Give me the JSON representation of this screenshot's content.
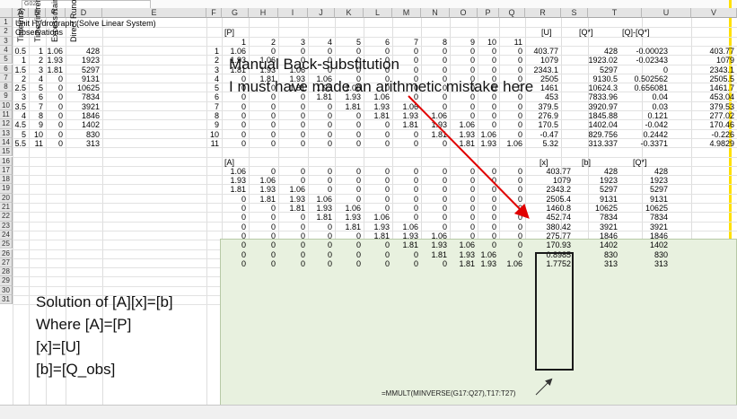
{
  "app": {
    "name_box": "G02"
  },
  "columns": [
    "A",
    "B",
    "C",
    "D",
    "E",
    "F",
    "G",
    "H",
    "I",
    "J",
    "K",
    "L",
    "M",
    "N",
    "O",
    "P",
    "Q",
    "R",
    "S",
    "T",
    "U",
    "V"
  ],
  "rows": [
    "1",
    "2",
    "3",
    "4",
    "5",
    "6",
    "7",
    "8",
    "9",
    "10",
    "11",
    "12",
    "13",
    "14",
    "15",
    "16",
    "17",
    "18",
    "19",
    "20",
    "21",
    "22",
    "23",
    "24",
    "25",
    "26",
    "27",
    "28",
    "29",
    "30",
    "31"
  ],
  "sheet": {
    "title": "Unit Hydrograph (Solve Linear System)",
    "observations": "Observations",
    "p_label": "[P]",
    "u_label": "[U]",
    "q_star_label": "[Q*]",
    "diff_label": "[Q]-[Q*]",
    "col_time": "Time(hrs)",
    "col_increment": "Time (increment)",
    "col_excess": "Excess Rain (in)",
    "col_runoff": "Direct Runoff (cfs",
    "obs": [
      [
        "0.5",
        "1",
        "1.06",
        "428"
      ],
      [
        "1",
        "2",
        "1.93",
        "1923"
      ],
      [
        "1.5",
        "3",
        "1.81",
        "5297"
      ],
      [
        "2",
        "4",
        "0",
        "9131"
      ],
      [
        "2.5",
        "5",
        "0",
        "10625"
      ],
      [
        "3",
        "6",
        "0",
        "7834"
      ],
      [
        "3.5",
        "7",
        "0",
        "3921"
      ],
      [
        "4",
        "8",
        "0",
        "1846"
      ],
      [
        "4.5",
        "9",
        "0",
        "1402"
      ],
      [
        "5",
        "10",
        "0",
        "830"
      ],
      [
        "5.5",
        "11",
        "0",
        "313"
      ]
    ],
    "p_header": [
      "1",
      "2",
      "3",
      "4",
      "5",
      "6",
      "7",
      "8",
      "9",
      "10",
      "11"
    ],
    "p_index": [
      "1",
      "2",
      "3",
      "4",
      "5",
      "6",
      "7",
      "8",
      "9",
      "10",
      "11"
    ],
    "p_matrix": [
      [
        "1.06",
        "0",
        "0",
        "0",
        "0",
        "0",
        "0",
        "0",
        "0",
        "0",
        "0"
      ],
      [
        "1.93",
        "1.06",
        "0",
        "0",
        "0",
        "0",
        "0",
        "0",
        "0",
        "0",
        "0"
      ],
      [
        "1.81",
        "1.93",
        "1.06",
        "0",
        "0",
        "0",
        "0",
        "0",
        "0",
        "0",
        "0"
      ],
      [
        "0",
        "1.81",
        "1.93",
        "1.06",
        "0",
        "0",
        "0",
        "0",
        "0",
        "0",
        "0"
      ],
      [
        "0",
        "0",
        "1.81",
        "1.93",
        "1.06",
        "0",
        "0",
        "0",
        "0",
        "0",
        "0"
      ],
      [
        "0",
        "0",
        "0",
        "1.81",
        "1.93",
        "1.06",
        "0",
        "0",
        "0",
        "0",
        "0"
      ],
      [
        "0",
        "0",
        "0",
        "0",
        "1.81",
        "1.93",
        "1.06",
        "0",
        "0",
        "0",
        "0"
      ],
      [
        "0",
        "0",
        "0",
        "0",
        "0",
        "1.81",
        "1.93",
        "1.06",
        "0",
        "0",
        "0"
      ],
      [
        "0",
        "0",
        "0",
        "0",
        "0",
        "0",
        "1.81",
        "1.93",
        "1.06",
        "0",
        "0"
      ],
      [
        "0",
        "0",
        "0",
        "0",
        "0",
        "0",
        "0",
        "1.81",
        "1.93",
        "1.06",
        "0"
      ],
      [
        "0",
        "0",
        "0",
        "0",
        "0",
        "0",
        "0",
        "0",
        "1.81",
        "1.93",
        "1.06"
      ]
    ],
    "u": [
      "403.77",
      "1079",
      "2343.1",
      "2505",
      "1461",
      "453",
      "379.5",
      "276.9",
      "170.5",
      "-0.47",
      "5.32"
    ],
    "q_star": [
      "428",
      "1923.02",
      "5297",
      "9130.5",
      "10624.3",
      "7833.96",
      "3920.97",
      "1845.88",
      "1402.04",
      "829.756",
      "313.337"
    ],
    "diff": [
      "-0.00023",
      "-0.02343",
      "0",
      "0.502562",
      "0.656081",
      "0.04",
      "0.03",
      "0.121",
      "-0.042",
      "0.2442",
      "-0.3371"
    ],
    "v_col": [
      "403.77",
      "1079",
      "2343.1",
      "2505.5",
      "1461.7",
      "453.04",
      "379.53",
      "277.02",
      "170.46",
      "-0.226",
      "4.9829"
    ]
  },
  "annotations": {
    "manual_1": "Manual Back-substitution",
    "manual_2": "I must have made an arithmetic mistake here",
    "solution_1": "Solution of [A][x]=[b]",
    "solution_2": "Where [A]=[P]",
    "solution_3": "[x]=[U]",
    "solution_4": "[b]=[Q_obs]"
  },
  "green": {
    "a_label": "[A]",
    "x_label": "[x]",
    "b_label": "[b]",
    "q_star_label": "[Q*]",
    "a_matrix": [
      [
        "1.06",
        "0",
        "0",
        "0",
        "0",
        "0",
        "0",
        "0",
        "0",
        "0",
        "0"
      ],
      [
        "1.93",
        "1.06",
        "0",
        "0",
        "0",
        "0",
        "0",
        "0",
        "0",
        "0",
        "0"
      ],
      [
        "1.81",
        "1.93",
        "1.06",
        "0",
        "0",
        "0",
        "0",
        "0",
        "0",
        "0",
        "0"
      ],
      [
        "0",
        "1.81",
        "1.93",
        "1.06",
        "0",
        "0",
        "0",
        "0",
        "0",
        "0",
        "0"
      ],
      [
        "0",
        "0",
        "1.81",
        "1.93",
        "1.06",
        "0",
        "0",
        "0",
        "0",
        "0",
        "0"
      ],
      [
        "0",
        "0",
        "0",
        "1.81",
        "1.93",
        "1.06",
        "0",
        "0",
        "0",
        "0",
        "0"
      ],
      [
        "0",
        "0",
        "0",
        "0",
        "1.81",
        "1.93",
        "1.06",
        "0",
        "0",
        "0",
        "0"
      ],
      [
        "0",
        "0",
        "0",
        "0",
        "0",
        "1.81",
        "1.93",
        "1.06",
        "0",
        "0",
        "0"
      ],
      [
        "0",
        "0",
        "0",
        "0",
        "0",
        "0",
        "1.81",
        "1.93",
        "1.06",
        "0",
        "0"
      ],
      [
        "0",
        "0",
        "0",
        "0",
        "0",
        "0",
        "0",
        "1.81",
        "1.93",
        "1.06",
        "0"
      ],
      [
        "0",
        "0",
        "0",
        "0",
        "0",
        "0",
        "0",
        "0",
        "1.81",
        "1.93",
        "1.06"
      ]
    ],
    "x": [
      "403.77",
      "1079",
      "2343.2",
      "2505.4",
      "1460.8",
      "452.74",
      "380.42",
      "275.77",
      "170.93",
      "0.8985",
      "1.7752"
    ],
    "b": [
      "428",
      "1923",
      "5297",
      "9131",
      "10625",
      "7834",
      "3921",
      "1846",
      "1402",
      "830",
      "313"
    ],
    "q_star": [
      "428",
      "1923",
      "5297",
      "9131",
      "10625",
      "7834",
      "3921",
      "1846",
      "1402",
      "830",
      "313"
    ],
    "formula": "=MMULT(MINVERSE(G17:Q27),T17:T27)"
  },
  "colors": {
    "green_panel": "#e8f1df",
    "arrow": "#e00000",
    "highlight": "#ffe000"
  }
}
